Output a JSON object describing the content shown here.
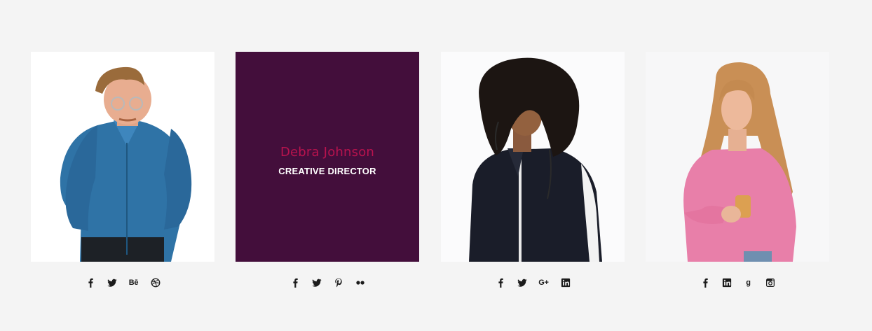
{
  "colors": {
    "page_bg": "#f4f4f4",
    "overlay_bg": "#430e3b",
    "name_accent": "#b8134e",
    "icon": "#1b1b1b"
  },
  "team": [
    {
      "photo": "man-blue-shirt-glasses",
      "socials": [
        {
          "icon": "facebook-icon"
        },
        {
          "icon": "twitter-icon"
        },
        {
          "icon": "behance-icon",
          "label": "Bē"
        },
        {
          "icon": "dribbble-icon"
        }
      ]
    },
    {
      "name": "Debra Johnson",
      "role": "CREATIVE DIRECTOR",
      "overlay": true,
      "socials": [
        {
          "icon": "facebook-icon"
        },
        {
          "icon": "twitter-icon"
        },
        {
          "icon": "pinterest-icon"
        },
        {
          "icon": "flickr-icon"
        }
      ]
    },
    {
      "photo": "man-curly-hair-track-jacket",
      "socials": [
        {
          "icon": "facebook-icon"
        },
        {
          "icon": "twitter-icon"
        },
        {
          "icon": "google-plus-icon",
          "label": "G+"
        },
        {
          "icon": "linkedin-icon"
        }
      ]
    },
    {
      "photo": "woman-pink-sweater",
      "socials": [
        {
          "icon": "facebook-icon"
        },
        {
          "icon": "linkedin-icon"
        },
        {
          "icon": "google-icon",
          "label": "g"
        },
        {
          "icon": "instagram-icon"
        }
      ]
    }
  ]
}
